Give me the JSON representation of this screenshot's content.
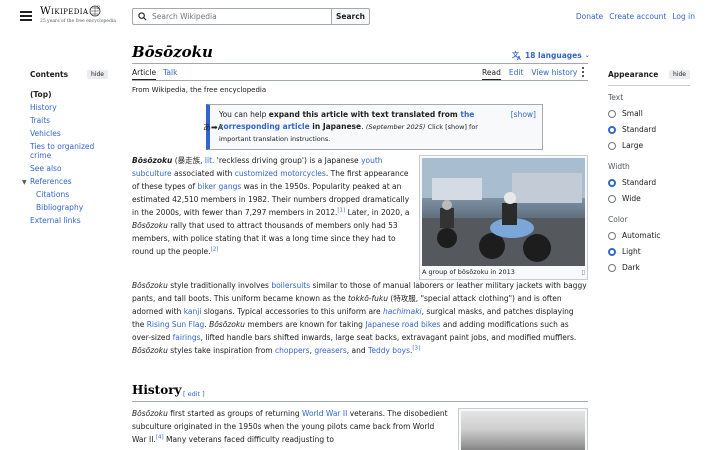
{
  "header": {
    "logo_title": "Wikipedia",
    "logo_subtitle": "25 years of the free encyclopedia",
    "search_placeholder": "Search Wikipedia",
    "search_button": "Search",
    "user_links": [
      "Donate",
      "Create account",
      "Log in"
    ]
  },
  "toc": {
    "title": "Contents",
    "hide_label": "hide",
    "items": [
      {
        "label": "(Top)",
        "level": 0
      },
      {
        "label": "History",
        "level": 0
      },
      {
        "label": "Traits",
        "level": 0
      },
      {
        "label": "Vehicles",
        "level": 0
      },
      {
        "label": "Ties to organized crime",
        "level": 0
      },
      {
        "label": "See also",
        "level": 0
      },
      {
        "label": "References",
        "level": 0
      },
      {
        "label": "Citations",
        "level": 1
      },
      {
        "label": "Bibliography",
        "level": 1
      },
      {
        "label": "External links",
        "level": 0
      }
    ]
  },
  "article": {
    "title": "Bōsōzoku",
    "languages": "18 languages",
    "tabs_left": [
      "Article",
      "Talk"
    ],
    "tabs_right": [
      "Read",
      "Edit",
      "View history"
    ],
    "from_line": "From Wikipedia, the free encyclopedia",
    "notice": {
      "text_1": "You can help ",
      "bold_1": "expand this article with text translated from ",
      "link": "the corresponding article",
      "bold_2": " in Japanese",
      "date": "(September 2025)",
      "text_2": " Click [show] for important translation instructions.",
      "show": "[show]",
      "icon": "あ➡A"
    },
    "image_caption": "A group of bōsōzoku in 2013",
    "section_history": "History",
    "edit_label": "edit"
  },
  "appearance": {
    "title": "Appearance",
    "hide_label": "hide",
    "text_label": "Text",
    "text_options": [
      "Small",
      "Standard",
      "Large"
    ],
    "text_selected": "Standard",
    "width_label": "Width",
    "width_options": [
      "Standard",
      "Wide"
    ],
    "width_selected": "Standard",
    "color_label": "Color",
    "color_options": [
      "Automatic",
      "Light",
      "Dark"
    ],
    "color_selected": "Light"
  },
  "colors": {
    "link": "#3366cc",
    "accent": "#36c",
    "border": "#a2a9b1"
  }
}
